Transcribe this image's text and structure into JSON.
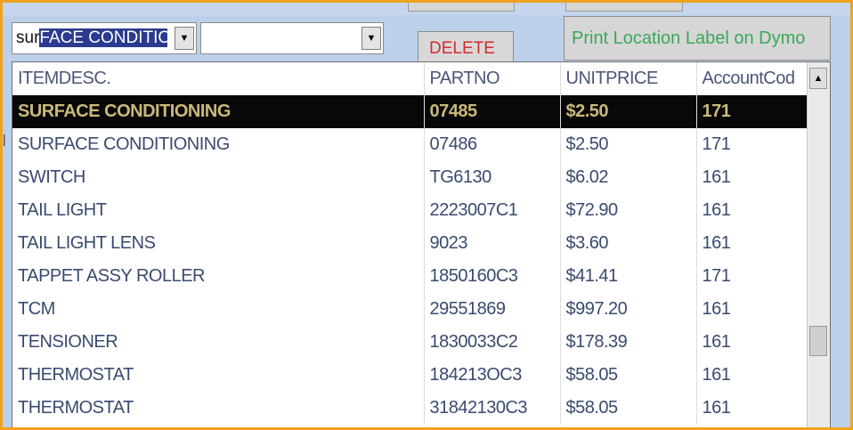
{
  "combo1": {
    "typed_text": "sur",
    "selected_text": "FACE CONDITIO"
  },
  "combo2": {
    "value": ""
  },
  "buttons": {
    "delete": "DELETE",
    "print_label": "Print Location Label on Dymo"
  },
  "columns": [
    "ITEMDESC.",
    "PARTNO",
    "UNITPRICE",
    "AccountCod"
  ],
  "selected_row_index": 0,
  "rows": [
    [
      "SURFACE CONDITIONING",
      "07485",
      "$2.50",
      "171"
    ],
    [
      "SURFACE CONDITIONING",
      "07486",
      "$2.50",
      "171"
    ],
    [
      "SWITCH",
      "TG6130",
      "$6.02",
      "161"
    ],
    [
      "TAIL LIGHT",
      "2223007C1",
      "$72.90",
      "161"
    ],
    [
      "TAIL LIGHT LENS",
      "9023",
      "$3.60",
      "161"
    ],
    [
      "TAPPET ASSY ROLLER",
      "1850160C3",
      "$41.41",
      "171"
    ],
    [
      "TCM",
      "29551869",
      "$997.20",
      "161"
    ],
    [
      "TENSIONER",
      "1830033C2",
      "$178.39",
      "161"
    ],
    [
      "THERMOSTAT",
      "184213OC3",
      "$58.05",
      "161"
    ],
    [
      "THERMOSTAT",
      "31842130C3",
      "$58.05",
      "161"
    ]
  ],
  "colors": {
    "frame": "#f0a21e",
    "background": "#bcd0ea",
    "selection": "#080808",
    "delete_text": "#d42a2a",
    "print_text": "#3aa85a"
  }
}
